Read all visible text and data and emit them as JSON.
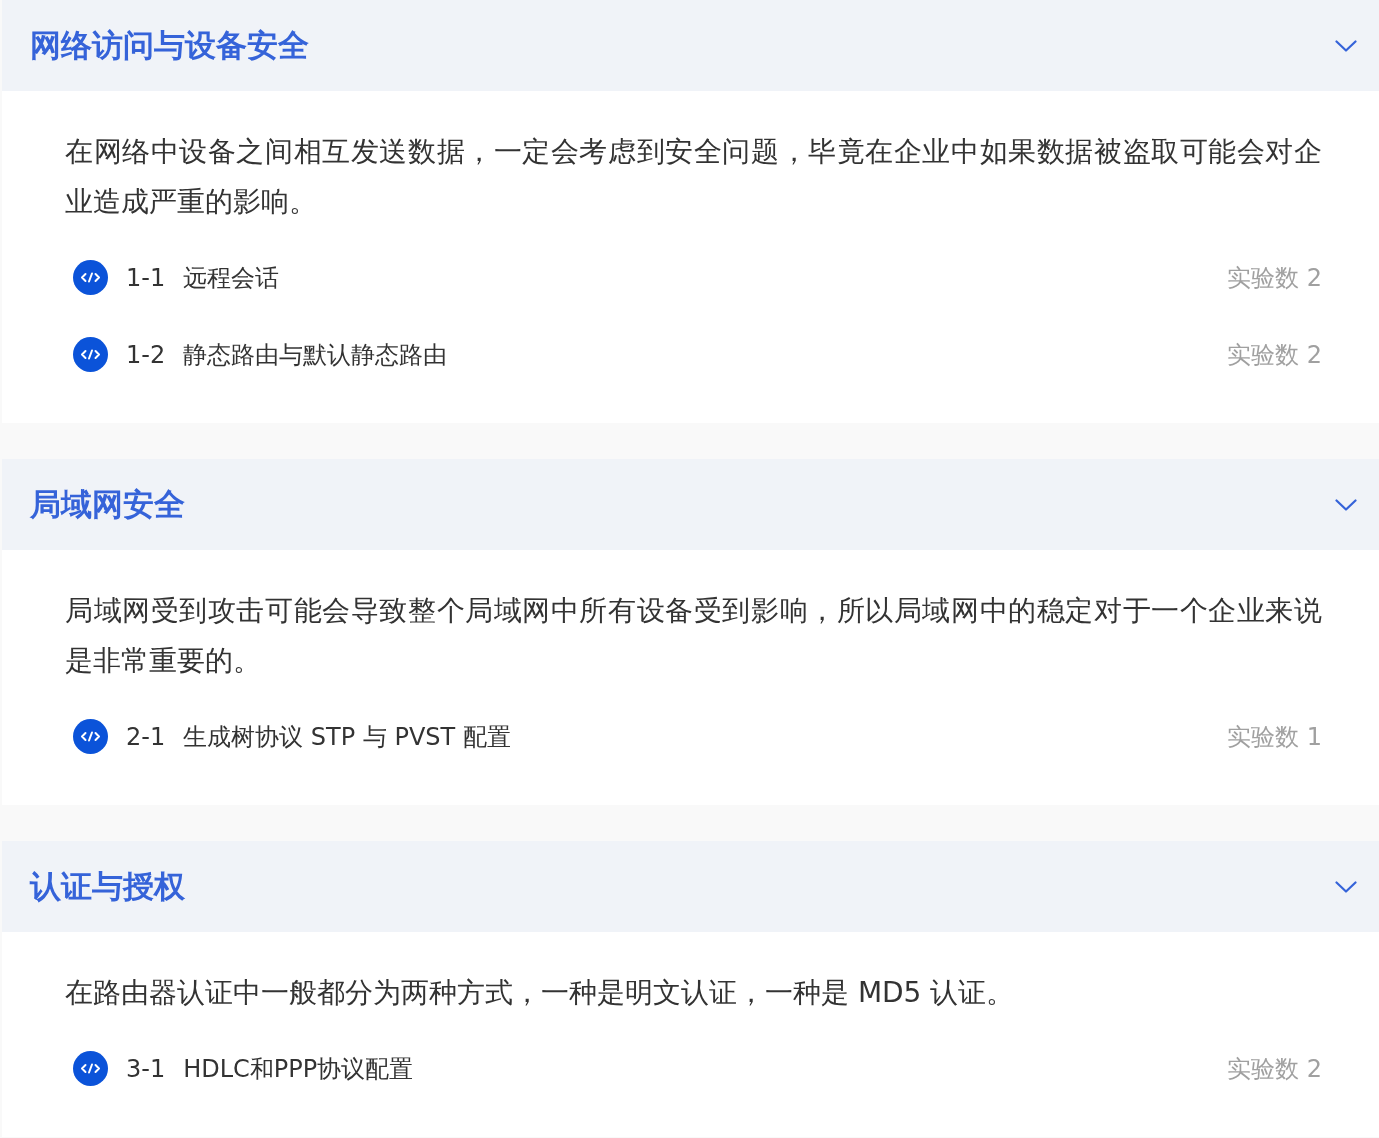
{
  "sections": [
    {
      "title": "网络访问与设备安全",
      "expanded": true,
      "description": "在网络中设备之间相互发送数据，一定会考虑到安全问题，毕竟在企业中如果数据被盗取可能会对企业造成严重的影响。",
      "labs": [
        {
          "code": "1-1",
          "title": "远程会话",
          "count": "实验数 2"
        },
        {
          "code": "1-2",
          "title": "静态路由与默认静态路由",
          "count": "实验数 2"
        }
      ]
    },
    {
      "title": "局域网安全",
      "expanded": true,
      "description": "局域网受到攻击可能会导致整个局域网中所有设备受到影响，所以局域网中的稳定对于一个企业来说是非常重要的。",
      "labs": [
        {
          "code": "2-1",
          "title": "生成树协议 STP 与 PVST 配置",
          "count": "实验数 1"
        }
      ]
    },
    {
      "title": "认证与授权",
      "expanded": true,
      "description": "在路由器认证中一般都分为两种方式，一种是明文认证，一种是 MD5 认证。",
      "labs": [
        {
          "code": "3-1",
          "title": "HDLC和PPP协议配置",
          "count": "实验数 2"
        }
      ]
    }
  ]
}
